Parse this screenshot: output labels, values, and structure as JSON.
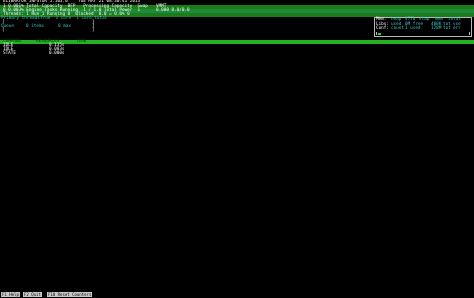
{
  "header": {
    "title_line": "ELIBRATOR INFSTOR 5.103.0    TUE MAY 21 08:30:41 2013",
    "line2_left": "1 0.001% Total Capacity  BFP   Processing Capacity  Swap",
    "line3_left": "0 0.003% Engine Tasks Running  1 / 1.0 Total Power  1",
    "line4_left": "Threads: 1 Run 1 Running 0  Blocked  0.0 = 0.0% 0",
    "line2_right": "VMMT",
    "line3_right": "0.000 0.0/0.0"
  },
  "threads_panel": {
    "label": "Primary threads:",
    "label_value": "True  1 core  1 core total",
    "row1": "[",
    "row1_end": "]",
    "queue_label": "Queue",
    "queue_items": "0 items",
    "queue_max": "0 max",
    "row3": "[",
    "row3_end": "]"
  },
  "mem_panel": {
    "rows": [
      {
        "label": "Mem:",
        "a": "heap",
        "b": "477k",
        "c": "stap",
        "d": "mem",
        "e": "total"
      },
      {
        "label": "Libs:",
        "a": "used",
        "b": "0M free",
        "c": "488K",
        "d": "tot",
        "e": "vse"
      },
      {
        "label": "Conf:",
        "a": "count",
        "b": "1 used",
        "c": "128M",
        "d": "tot",
        "e": "err"
      }
    ]
  },
  "section_header": {
    "col1": "COMMAND",
    "col2": "RESOURCES",
    "col3": "TIME"
  },
  "table": {
    "rows": [
      {
        "name": "IDLE",
        "value": "0.135s"
      },
      {
        "name": "IDLE",
        "value": "0.003s"
      },
      {
        "name": "STATE",
        "value": "0.000s"
      }
    ]
  },
  "footer": {
    "buttons": [
      "F1 Help",
      "F2 Quit",
      "F10 Reset Counters"
    ]
  },
  "colors": {
    "accent_green": "#3ad13a",
    "cyan": "#39c6c6",
    "background": "#000000"
  }
}
